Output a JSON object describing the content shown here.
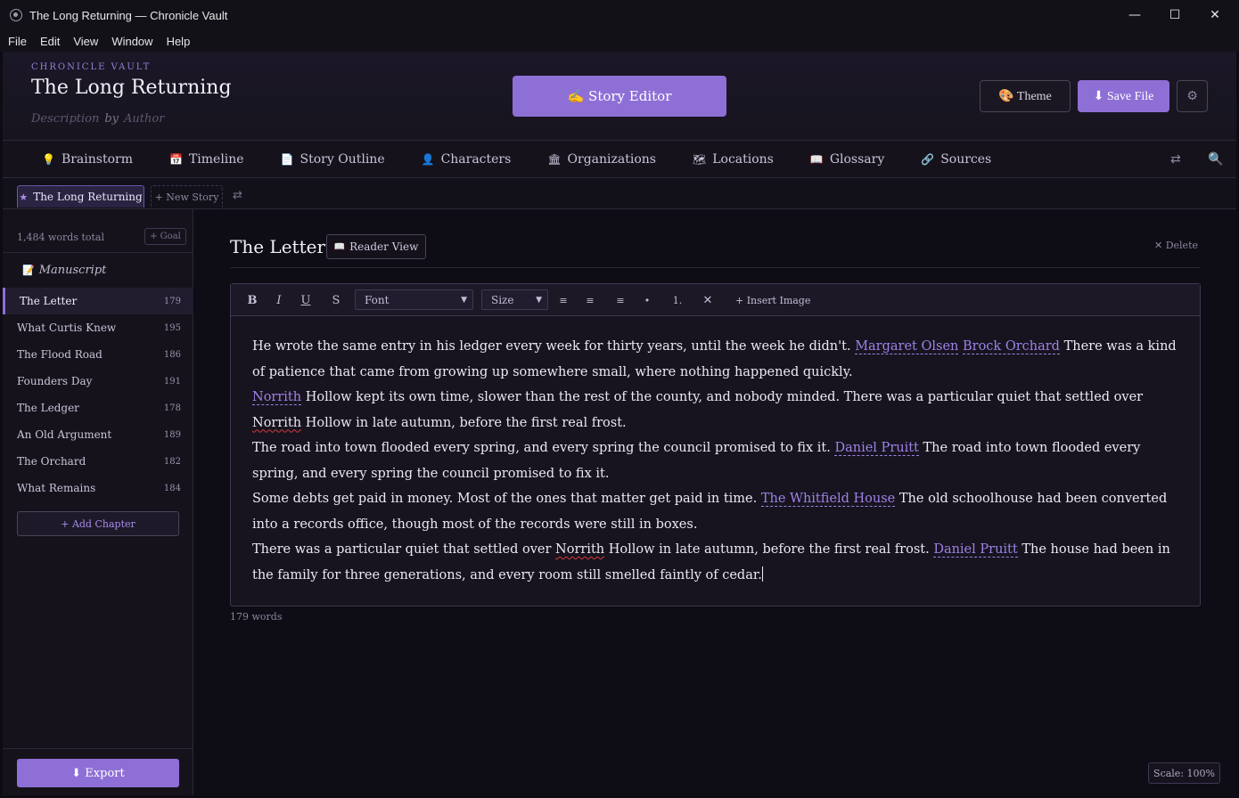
{
  "window": {
    "title": "The Long Returning — Chronicle Vault",
    "controls": {
      "minimize": "—",
      "maximize": "☐",
      "close": "✕"
    }
  },
  "menubar": [
    "File",
    "Edit",
    "View",
    "Window",
    "Help"
  ],
  "header": {
    "vault_label": "CHRONICLE VAULT",
    "story_title": "The Long Returning",
    "description_placeholder": "Description",
    "by": "by",
    "author_placeholder": "Author",
    "story_editor_label": "✍ Story Editor",
    "theme_label": "🎨 Theme",
    "save_label": "⬇ Save File",
    "settings_icon": "⚙"
  },
  "nav": {
    "tabs": [
      {
        "icon": "💡",
        "label": "Brainstorm"
      },
      {
        "icon": "📅",
        "label": "Timeline"
      },
      {
        "icon": "📄",
        "label": "Story Outline"
      },
      {
        "icon": "👤",
        "label": "Characters"
      },
      {
        "icon": "🏛",
        "label": "Organizations"
      },
      {
        "icon": "🗺",
        "label": "Locations"
      },
      {
        "icon": "📖",
        "label": "Glossary"
      },
      {
        "icon": "🔗",
        "label": "Sources"
      }
    ],
    "swap_icon": "⇄",
    "search_icon": "🔍"
  },
  "story_tabs": {
    "active": "The Long Returning",
    "active_icon": "★",
    "new_story": "+ New Story",
    "swap_icon": "⇄"
  },
  "sidebar": {
    "words_total": "1,484 words total",
    "goal": "+ Goal",
    "manuscript_icon": "📝",
    "manuscript": "Manuscript",
    "chapters": [
      {
        "title": "The Letter",
        "words": "179",
        "active": true
      },
      {
        "title": "What Curtis Knew",
        "words": "195"
      },
      {
        "title": "The Flood Road",
        "words": "186"
      },
      {
        "title": "Founders Day",
        "words": "191"
      },
      {
        "title": "The Ledger",
        "words": "178"
      },
      {
        "title": "An Old Argument",
        "words": "189"
      },
      {
        "title": "The Orchard",
        "words": "182"
      },
      {
        "title": "What Remains",
        "words": "184"
      }
    ],
    "add_chapter": "+ Add Chapter",
    "export": "⬇ Export"
  },
  "editor": {
    "chapter_title": "The Letter",
    "reader_view_icon": "📖",
    "reader_view": "Reader View",
    "delete": "✕ Delete",
    "toolbar": {
      "bold": "B",
      "italic": "I",
      "underline": "U",
      "strike": "S",
      "font": "Font",
      "size": "Size",
      "align_left": "≡",
      "align_center": "≡",
      "align_right": "≡",
      "bullet": "•",
      "numbered": "1.",
      "clear": "✕",
      "insert_image": "+ Insert Image"
    },
    "paragraphs": [
      [
        {
          "t": "He wrote the same entry in his ledger every week for thirty years, until the week he didn't. "
        },
        {
          "t": "Margaret Olsen",
          "ref": true
        },
        {
          "t": " "
        },
        {
          "t": "Brock Orchard",
          "ref": true
        },
        {
          "t": " There was a kind of patience that came from growing up somewhere small, where nothing happened quickly."
        }
      ],
      [
        {
          "t": "Norrith",
          "ref": true
        },
        {
          "t": " Hollow kept its own time, slower than the rest of the county, and nobody minded. There was a particular quiet that settled over "
        },
        {
          "t": "Norrith",
          "spell": true
        },
        {
          "t": " Hollow in late autumn, before the first real frost."
        }
      ],
      [
        {
          "t": "The road into town flooded every spring, and every spring the council promised to fix it. "
        },
        {
          "t": "Daniel Pruitt",
          "ref": true
        },
        {
          "t": " The road into town flooded every spring, and every spring the council promised to fix it."
        }
      ],
      [
        {
          "t": "Some debts get paid in money. Most of the ones that matter get paid in time. "
        },
        {
          "t": "The Whitfield House",
          "ref": true
        },
        {
          "t": " The old schoolhouse had been converted into a records office, though most of the records were still in boxes."
        }
      ],
      [
        {
          "t": "There was a particular quiet that settled over "
        },
        {
          "t": "Norrith",
          "spell": true
        },
        {
          "t": " Hollow in late autumn, before the first real frost. "
        },
        {
          "t": "Daniel Pruitt",
          "ref": true
        },
        {
          "t": " The house had been in the family for three generations, and every room still smelled faintly of cedar."
        }
      ]
    ],
    "word_count": "179 words"
  },
  "status": {
    "scale": "Scale: 100%"
  },
  "colors": {
    "accent": "#8e6fd6",
    "link": "#9f82e8",
    "background": "#0e0c14",
    "spellcheck": "#d23a3a"
  }
}
